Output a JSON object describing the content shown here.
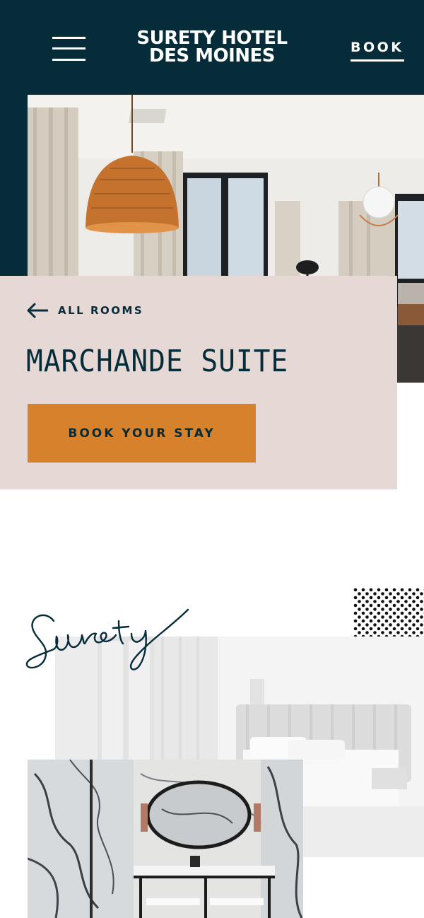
{
  "header": {
    "logo_line1": "SURETY HOTEL",
    "logo_line2": "DES MOINES",
    "book_label": "BOOK",
    "bg_color": "#062c3a"
  },
  "room": {
    "back_label": "ALL ROOMS",
    "title": "MARCHANDE SUITE",
    "cta_label": "BOOK YOUR STAY",
    "card_color": "#e6d8d5",
    "cta_color": "#d6812b"
  },
  "collage": {
    "script_word": "Surety"
  },
  "icons": {
    "menu": "hamburger-icon",
    "back": "arrow-left-icon"
  }
}
